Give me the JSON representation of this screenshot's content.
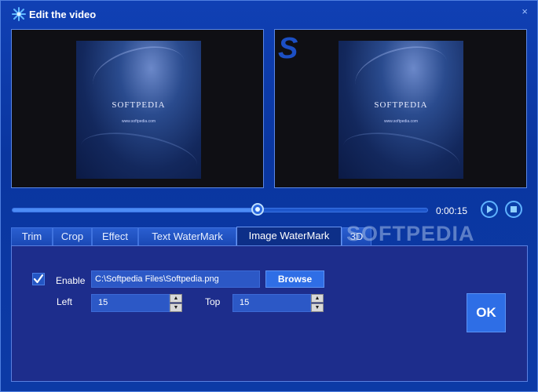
{
  "window": {
    "title": "Edit the video",
    "close_label": "×"
  },
  "preview": {
    "brand": "SOFTPEDIA",
    "url": "www.softpedia.com",
    "watermark_letter": "S"
  },
  "playback": {
    "time": "0:00:15",
    "progress": 0.6
  },
  "tabs": [
    {
      "label": "Trim"
    },
    {
      "label": "Crop"
    },
    {
      "label": "Effect"
    },
    {
      "label": "Text WaterMark"
    },
    {
      "label": "Image WaterMark",
      "active": true
    },
    {
      "label": "3D"
    }
  ],
  "watermark": {
    "enable_label": "Enable",
    "enabled": true,
    "file_path": "C:\\Softpedia Files\\Softpedia.png",
    "browse_label": "Browse",
    "left_label": "Left",
    "left_value": "15",
    "top_label": "Top",
    "top_value": "15"
  },
  "ok_label": "OK",
  "overlay_watermark": "SOFTPEDIA",
  "colors": {
    "accent": "#2e6ee6",
    "background": "#0a3ea8",
    "panel": "#1d2d8c"
  }
}
